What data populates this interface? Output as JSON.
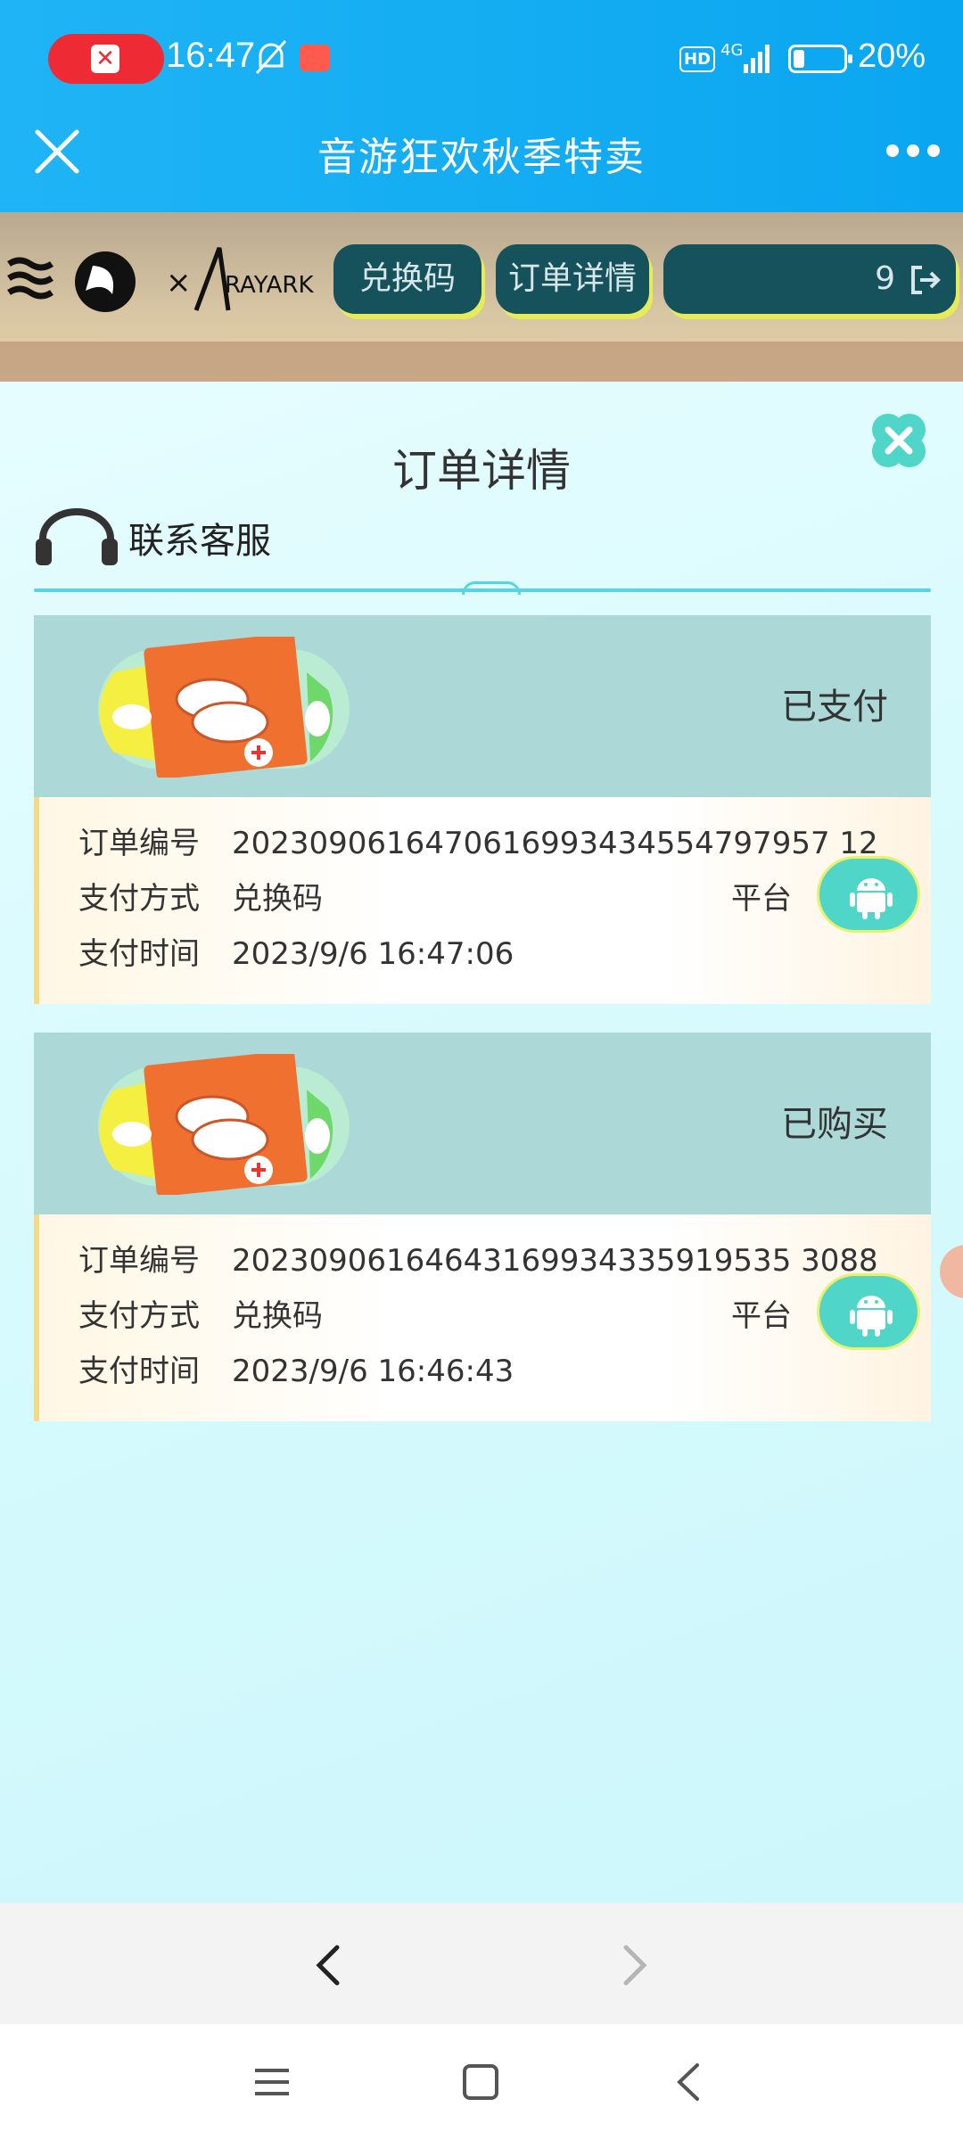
{
  "status_bar": {
    "time": "16:47",
    "network": "4G",
    "hd": "HD",
    "battery_percent": "20%",
    "battery_level": 0.2
  },
  "title_bar": {
    "title": "音游狂欢秋季特卖"
  },
  "banner": {
    "redeem_label": "兑换码",
    "order_label": "订单详情",
    "account_tail": "9"
  },
  "modal": {
    "title": "订单详情",
    "customer_service": "联系客服",
    "orders": [
      {
        "status": "已支付",
        "order_no_label": "订单编号",
        "order_no": "2023090616470616993434554797957 12",
        "pay_method_label": "支付方式",
        "pay_method": "兑换码",
        "platform_label": "平台",
        "pay_time_label": "支付时间",
        "pay_time": "2023/9/6 16:47:06"
      },
      {
        "status": "已购买",
        "order_no_label": "订单编号",
        "order_no": "20230906164643169934335919535 3088",
        "pay_method_label": "支付方式",
        "pay_method": "兑换码",
        "platform_label": "平台",
        "pay_time_label": "支付时间",
        "pay_time": "2023/9/6 16:46:43"
      }
    ]
  },
  "colors": {
    "accent": "#0aa6f0",
    "card_head": "#acd8d7",
    "android": "#4fd6c8",
    "nav_button": "#16525b"
  }
}
